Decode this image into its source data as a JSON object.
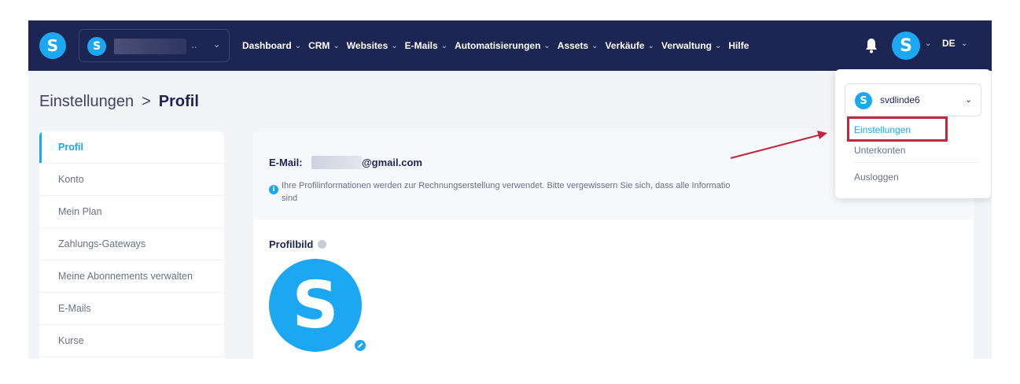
{
  "colors": {
    "nav_bg": "#1d2553",
    "brand": "#1ba7f2",
    "annotation": "#c0283d"
  },
  "nav": {
    "logo_letter": "S",
    "account_letter": "S",
    "account_ellipsis": "..",
    "items": [
      "Dashboard",
      "CRM",
      "Websites",
      "E-Mails",
      "Automatisierungen",
      "Assets",
      "Verkäufe",
      "Verwaltung"
    ],
    "help": "Hilfe",
    "avatar_letter": "S",
    "lang": "DE"
  },
  "breadcrumb": {
    "parent": "Einstellungen",
    "separator": ">",
    "current": "Profil"
  },
  "sidebar": {
    "items": [
      "Profil",
      "Konto",
      "Mein Plan",
      "Zahlungs-Gateways",
      "Meine Abonnements verwalten",
      "E-Mails",
      "Kurse"
    ]
  },
  "profile": {
    "email_label": "E-Mail:",
    "email_domain": "@gmail.com",
    "info_text": "Ihre Profilinformationen werden zur Rechnungserstellung verwendet. Bitte vergewissern Sie sich, dass alle Informatio",
    "info_text_2": "sind",
    "picture_title": "Profilbild",
    "avatar_letter": "S"
  },
  "dropdown": {
    "account_letter": "S",
    "account_name": "svdlinde6",
    "items": [
      "Einstellungen",
      "Unterkonten",
      "Ausloggen"
    ]
  }
}
